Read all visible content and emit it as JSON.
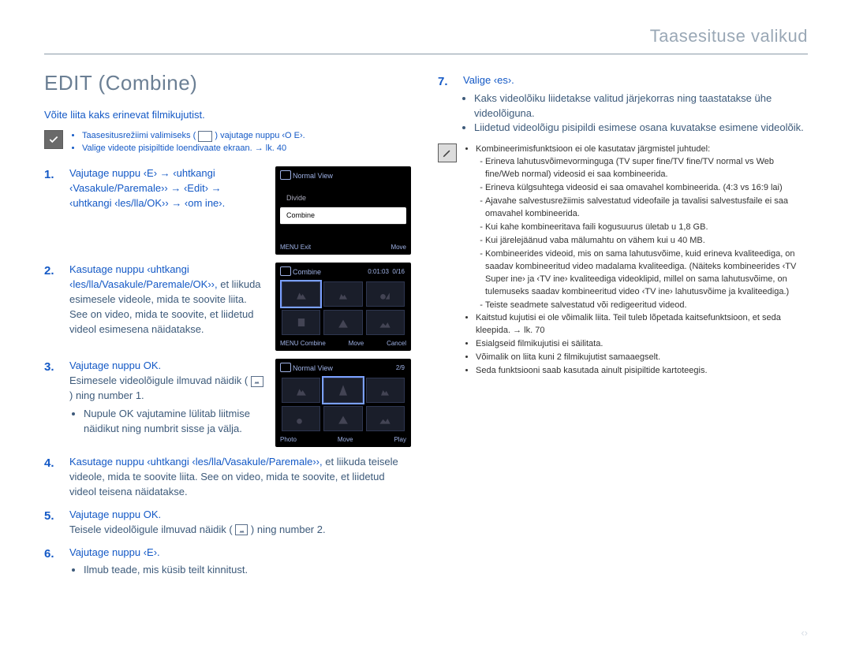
{
  "header": "Taasesituse valikud",
  "title": "EDIT (Combine)",
  "intro": "Võite liita kaks erinevat filmikujutist.",
  "tip": {
    "0": {
      "a": "Taasesitusrežiimi valimiseks (",
      "b": ") vajutage nuppu ‹O E›."
    },
    "1": "Valige videote pisipiltide loendivaate ekraan. → lk. 40"
  },
  "steps": [
    {
      "n": "1.",
      "text": "Vajutage nuppu ‹E› → ‹uhtkangi ‹Vasakule/Paremale›› → ‹Edit› → ‹uhtkangi ‹les/lla/OK›› → ‹om ine›."
    },
    {
      "n": "2.",
      "lead": "Kasutage nuppu ‹uhtkangi ‹les/lla/Vasakule/Paremale/OK››, ",
      "rest": "et liikuda esimesele videole, mida te soovite liita. See on video, mida te soovite, et liidetud videol esimesena näidatakse."
    },
    {
      "n": "3.",
      "lead": "Vajutage nuppu OK.",
      "line2a": "Esimesele videolõigule ilmuvad näidik (",
      "line2b": ") ning number 1.",
      "sub": "Nupule OK vajutamine lülitab liitmise näidikut ning numbrit sisse ja välja."
    },
    {
      "n": "4.",
      "lead": "Kasutage nuppu ‹uhtkangi ‹les/lla/Vasakule/Paremale››, ",
      "rest": "et liikuda teisele videole, mida te soovite liita. See on video, mida te soovite, et liidetud videol teisena näidatakse."
    },
    {
      "n": "5.",
      "lead": "Vajutage nuppu OK.",
      "line2a": "Teisele videolõigule ilmuvad näidik (",
      "line2b": ") ning number 2."
    },
    {
      "n": "6.",
      "lead": "Vajutage nuppu ‹E›.",
      "sub": "Ilmub teade, mis küsib teilt kinnitust."
    },
    {
      "n": "7.",
      "lead": "Valige ‹es›.",
      "bullets": [
        "Kaks videolõiku liidetakse valitud järjekorras ning taastatakse ühe videolõiguna.",
        "Liidetud videolõigu pisipildi esimese osana kuvatakse esimene videolõik."
      ]
    }
  ],
  "lcd1": {
    "title": "Normal View",
    "items": [
      "Divide",
      "Combine"
    ],
    "bottom": [
      "MENU Exit",
      "Move"
    ]
  },
  "lcd2": {
    "title": "Combine",
    "time": "0:01:03",
    "count": "0/16",
    "bottom": [
      "MENU Combine",
      "Move",
      "Cancel"
    ]
  },
  "lcd3": {
    "title": "Normal View",
    "count": "2/9",
    "bottom": [
      "Photo",
      "Move",
      "Play"
    ]
  },
  "notes": {
    "0": {
      "head": "Kombineerimisfunktsioon ei ole kasutatav järgmistel juhtudel:",
      "sub": [
        "Erineva lahutusvõimevorminguga (TV super fine/TV fine/TV normal vs Web fine/Web normal) videosid ei saa kombineerida.",
        "Erineva külgsuhtega videosid ei saa omavahel kombineerida. (4:3 vs 16:9 lai)",
        "Ajavahe salvestusrežiimis salvestatud videofaile ja tavalisi salvestusfaile ei saa omavahel kombineerida.",
        "Kui kahe kombineeritava faili kogusuurus ületab u 1,8 GB.",
        "Kui järelejäänud vaba mälumahtu on vähem kui u 40 MB.",
        "Kombineerides videoid, mis on sama lahutusvõime, kuid erineva kvaliteediga, on saadav kombineeritud video madalama kvaliteediga. (Näiteks kombineerides ‹TV Super ine› ja ‹TV ine› kvaliteediga videoklipid, millel on sama lahutusvõime, on tulemuseks saadav kombineeritud video ‹TV ine› lahutusvõime ja kvaliteediga.)",
        "Teiste seadmete salvestatud või redigeeritud videod."
      ]
    },
    "1": "Kaitstud kujutisi ei ole võimalik liita. Teil tuleb lõpetada kaitsefunktsioon, et seda kleepida. → lk. 70",
    "2": "Esialgseid filmikujutisi ei säilitata.",
    "3": "Võimalik on liita kuni 2 filmikujutist samaaegselt.",
    "4": "Seda funktsiooni saab kasutada ainult pisipiltide kartoteegis."
  },
  "pagenum": "‹›"
}
